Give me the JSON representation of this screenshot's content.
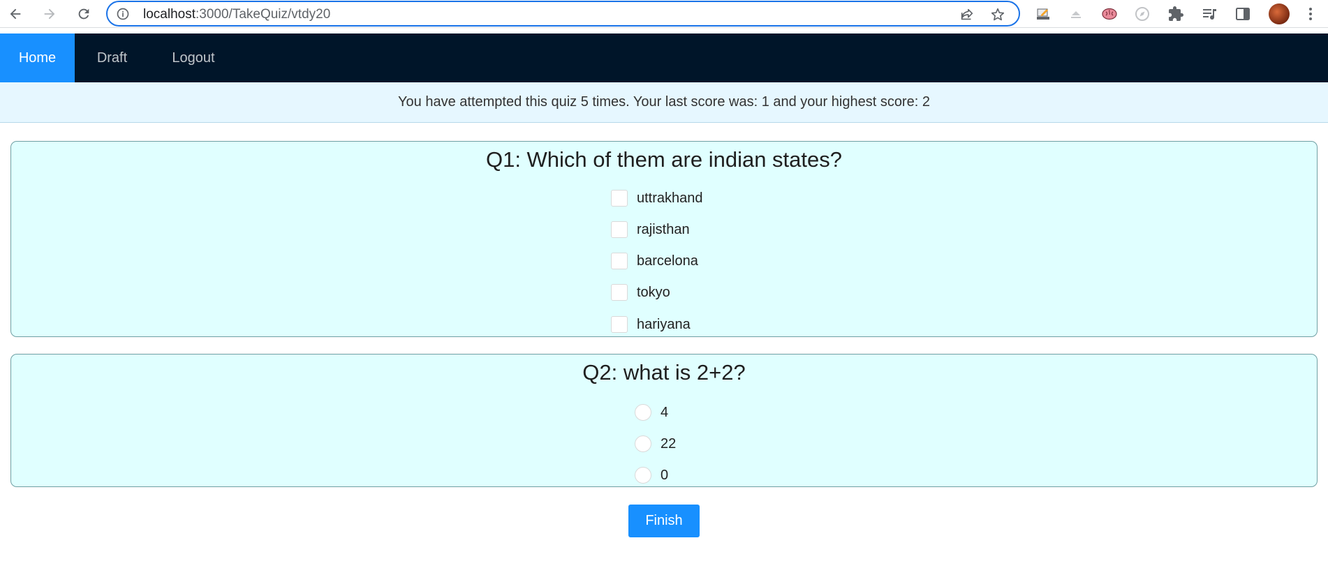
{
  "browser": {
    "url_host": "localhost",
    "url_path": ":3000/TakeQuiz/vtdy20"
  },
  "navbar": {
    "items": [
      {
        "label": "Home",
        "active": true
      },
      {
        "label": "Draft",
        "active": false
      },
      {
        "label": "Logout",
        "active": false
      }
    ]
  },
  "alert": {
    "text": "You have attempted this quiz 5 times. Your last score was: 1 and your highest score: 2"
  },
  "questions": [
    {
      "title": "Q1: Which of them are indian states?",
      "type": "checkbox",
      "options": [
        "uttrakhand",
        "rajisthan",
        "barcelona",
        "tokyo",
        "hariyana"
      ]
    },
    {
      "title": "Q2: what is 2+2?",
      "type": "radio",
      "options": [
        "4",
        "22",
        "0"
      ]
    }
  ],
  "finish_label": "Finish",
  "colors": {
    "nav_bg": "#001529",
    "accent": "#1890ff",
    "alert_bg": "#e6f7ff",
    "card_bg": "#e0ffff"
  }
}
